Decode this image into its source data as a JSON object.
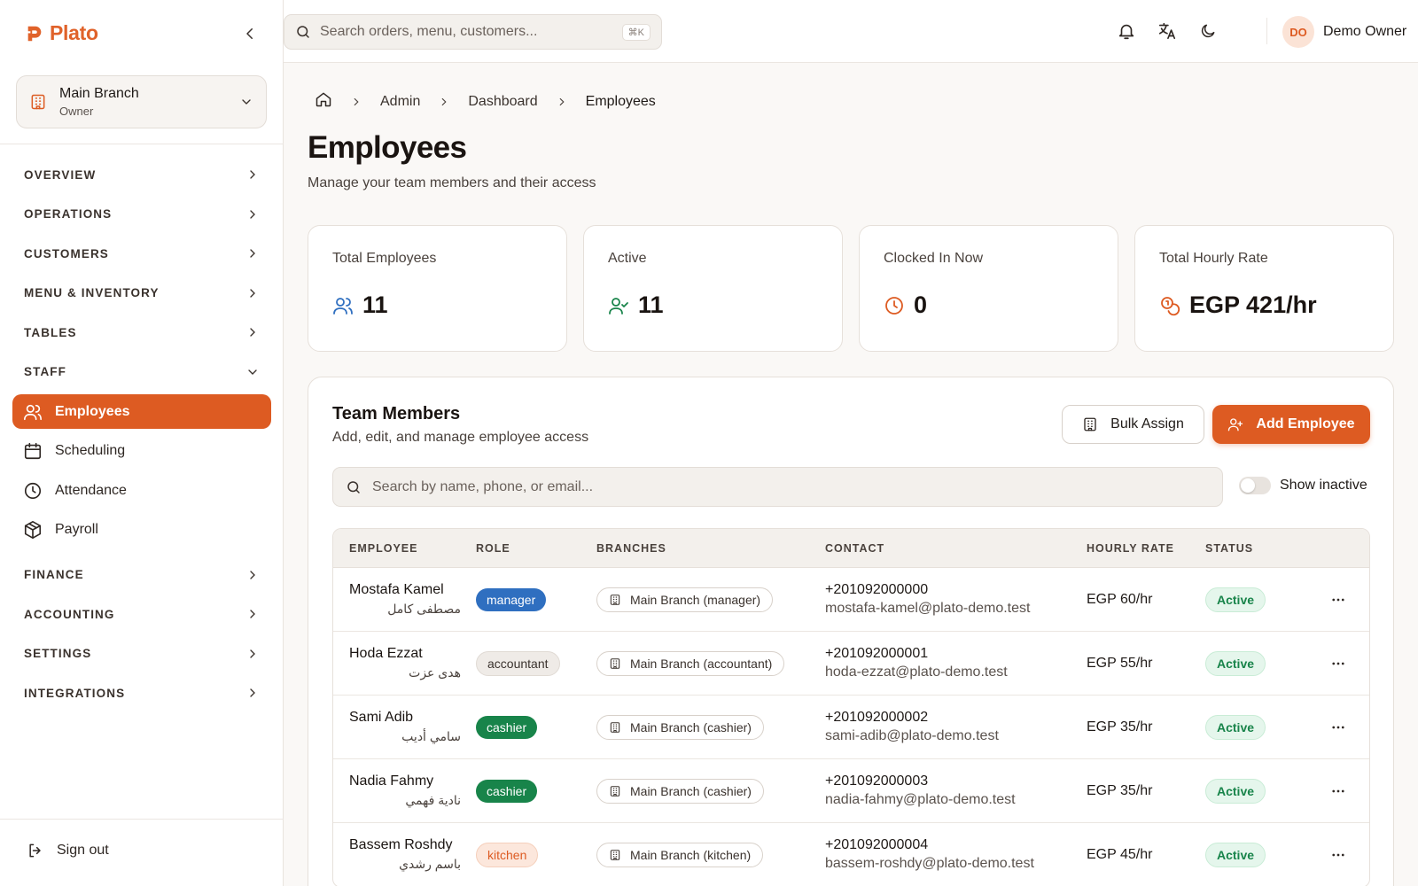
{
  "brand": {
    "name": "Plato",
    "accent": "#dd5b22"
  },
  "branch": {
    "name": "Main Branch",
    "role": "Owner"
  },
  "nav": {
    "sections_top": [
      {
        "label": "OVERVIEW",
        "key": "overview"
      },
      {
        "label": "OPERATIONS",
        "key": "operations"
      },
      {
        "label": "CUSTOMERS",
        "key": "customers"
      },
      {
        "label": "MENU & INVENTORY",
        "key": "menu-inventory"
      },
      {
        "label": "TABLES",
        "key": "tables"
      }
    ],
    "staff": {
      "label": "STAFF",
      "items": [
        {
          "label": "Employees",
          "icon": "users-icon",
          "active": true
        },
        {
          "label": "Scheduling",
          "icon": "calendar-icon"
        },
        {
          "label": "Attendance",
          "icon": "clock-icon"
        },
        {
          "label": "Payroll",
          "icon": "package-icon"
        }
      ]
    },
    "sections_bottom": [
      {
        "label": "FINANCE",
        "key": "finance"
      },
      {
        "label": "ACCOUNTING",
        "key": "accounting"
      },
      {
        "label": "SETTINGS",
        "key": "settings"
      },
      {
        "label": "INTEGRATIONS",
        "key": "integrations"
      }
    ],
    "signout": "Sign out"
  },
  "topbar": {
    "search_placeholder": "Search orders, menu, customers...",
    "shortcut": "⌘K",
    "user_initials": "DO",
    "user_name": "Demo Owner"
  },
  "breadcrumb": [
    "Admin",
    "Dashboard",
    "Employees"
  ],
  "page": {
    "title": "Employees",
    "subtitle": "Manage your team members and their access"
  },
  "stats": [
    {
      "label": "Total Employees",
      "value": "11",
      "icon": "users-icon",
      "color": "#2f6fc0"
    },
    {
      "label": "Active",
      "value": "11",
      "icon": "user-check-icon",
      "color": "#18844a"
    },
    {
      "label": "Clocked In Now",
      "value": "0",
      "icon": "clock-icon",
      "color": "#dd5b22"
    },
    {
      "label": "Total Hourly Rate",
      "value": "EGP 421/hr",
      "icon": "coins-icon",
      "color": "#dd5b22"
    }
  ],
  "team": {
    "title": "Team Members",
    "subtitle": "Add, edit, and manage employee access",
    "bulk_label": "Bulk Assign",
    "add_label": "Add Employee",
    "search_placeholder": "Search by name, phone, or email...",
    "toggle_label": "Show inactive",
    "columns": [
      "EMPLOYEE",
      "ROLE",
      "BRANCHES",
      "CONTACT",
      "HOURLY RATE",
      "STATUS"
    ],
    "rows": [
      {
        "name": "Mostafa Kamel",
        "name_ar": "مصطفى كامل",
        "role": "manager",
        "branch": "Main Branch (manager)",
        "phone": "+201092000000",
        "email": "mostafa-kamel@plato-demo.test",
        "rate": "EGP 60/hr",
        "status": "Active"
      },
      {
        "name": "Hoda Ezzat",
        "name_ar": "هدى عزت",
        "role": "accountant",
        "branch": "Main Branch (accountant)",
        "phone": "+201092000001",
        "email": "hoda-ezzat@plato-demo.test",
        "rate": "EGP 55/hr",
        "status": "Active"
      },
      {
        "name": "Sami Adib",
        "name_ar": "سامي أديب",
        "role": "cashier",
        "branch": "Main Branch (cashier)",
        "phone": "+201092000002",
        "email": "sami-adib@plato-demo.test",
        "rate": "EGP 35/hr",
        "status": "Active"
      },
      {
        "name": "Nadia Fahmy",
        "name_ar": "نادية فهمي",
        "role": "cashier",
        "branch": "Main Branch (cashier)",
        "phone": "+201092000003",
        "email": "nadia-fahmy@plato-demo.test",
        "rate": "EGP 35/hr",
        "status": "Active"
      },
      {
        "name": "Bassem Roshdy",
        "name_ar": "باسم رشدي",
        "role": "kitchen",
        "branch": "Main Branch (kitchen)",
        "phone": "+201092000004",
        "email": "bassem-roshdy@plato-demo.test",
        "rate": "EGP 45/hr",
        "status": "Active"
      }
    ]
  }
}
